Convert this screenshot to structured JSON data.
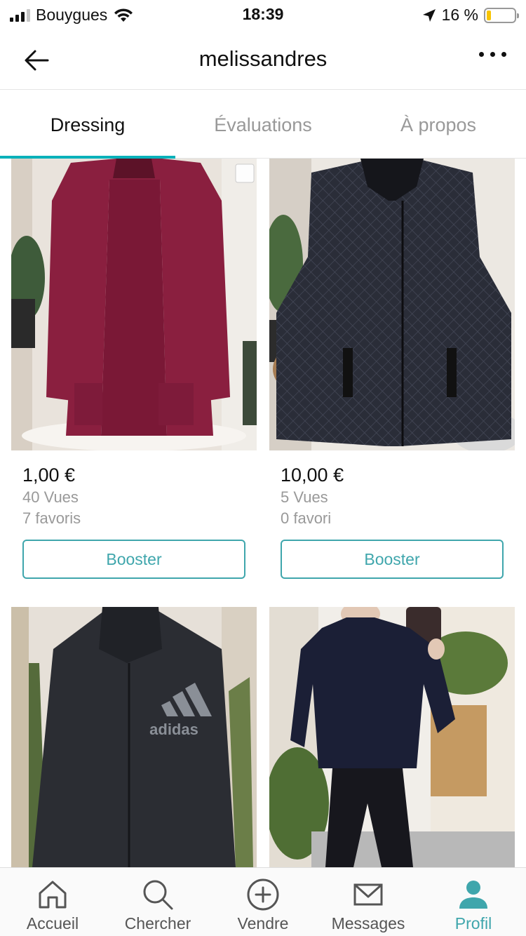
{
  "status_bar": {
    "carrier": "Bouygues",
    "time": "18:39",
    "battery_text": "16 %",
    "battery_level": 0.16,
    "signal_bars": 3
  },
  "header": {
    "title": "melissandres"
  },
  "tabs": [
    {
      "label": "Dressing",
      "active": true
    },
    {
      "label": "Évaluations",
      "active": false
    },
    {
      "label": "À propos",
      "active": false
    }
  ],
  "items": [
    {
      "price": "1,00 €",
      "views": "40 Vues",
      "favorites": "7 favoris",
      "button": "Booster",
      "photo": "burgundy-cardigan"
    },
    {
      "price": "10,00 €",
      "views": "5 Vues",
      "favorites": "0 favori",
      "button": "Booster",
      "photo": "navy-quilted-vest"
    },
    {
      "photo": "adidas-hoodie",
      "logo_text": "adidas"
    },
    {
      "photo": "navy-sweater"
    }
  ],
  "bottom_nav": [
    {
      "label": "Accueil",
      "icon": "home-icon",
      "active": false
    },
    {
      "label": "Chercher",
      "icon": "search-icon",
      "active": false
    },
    {
      "label": "Vendre",
      "icon": "plus-circle-icon",
      "active": false
    },
    {
      "label": "Messages",
      "icon": "mail-icon",
      "active": false
    },
    {
      "label": "Profil",
      "icon": "profile-icon",
      "active": true
    }
  ],
  "colors": {
    "accent": "#09b1ba",
    "booster": "#3fa6ac",
    "muted_text": "#999999"
  }
}
